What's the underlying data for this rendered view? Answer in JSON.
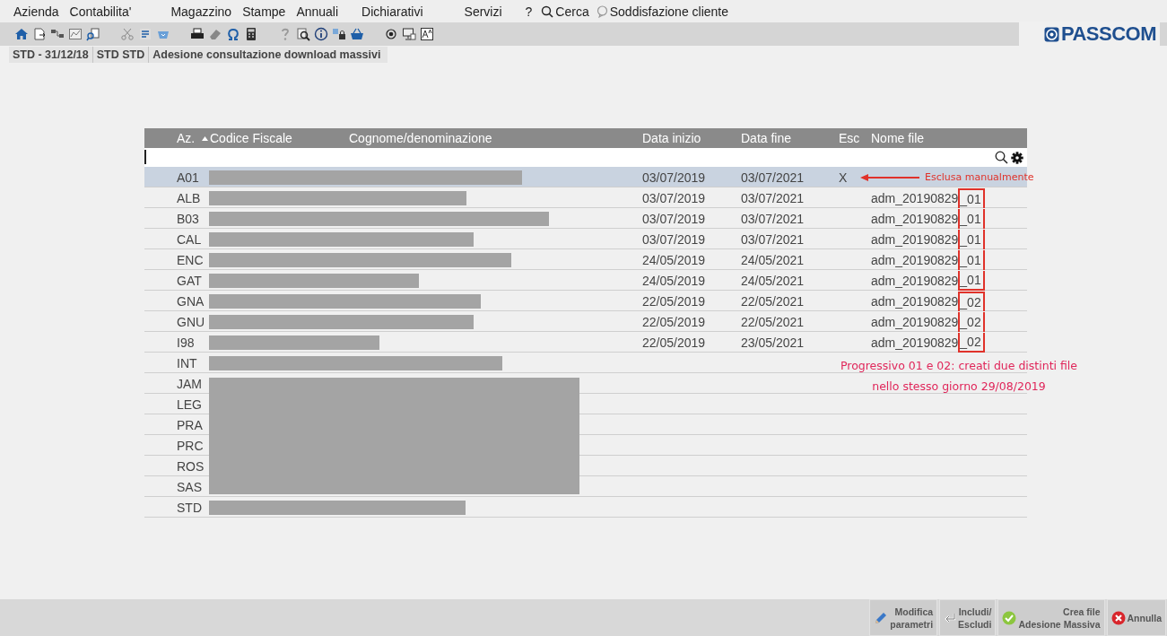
{
  "menu": [
    {
      "label": "Azienda"
    },
    {
      "label": "Contabilita'"
    },
    {
      "label": "Magazzino"
    },
    {
      "label": "Stampe"
    },
    {
      "label": "Annuali"
    },
    {
      "label": "Dichiarativi"
    },
    {
      "label": "Servizi"
    }
  ],
  "help": "?",
  "search_label": "Cerca",
  "satisfaction_label": "Soddisfazione cliente",
  "logo": "PASSCOM",
  "breadcrumbs": [
    "STD - 31/12/18",
    "STD STD",
    "Adesione consultazione download massivi"
  ],
  "table": {
    "columns": [
      "Az.",
      "Codice Fiscale",
      "Cognome/denominazione",
      "Data inizio",
      "Data fine",
      "Esc",
      "Nome file"
    ],
    "rows": [
      {
        "az": "A01",
        "data_inizio": "03/07/2019",
        "data_fine": "03/07/2021",
        "esc": "X",
        "note": "Esclusa manualmente",
        "selected": true
      },
      {
        "az": "ALB",
        "data_inizio": "03/07/2019",
        "data_fine": "03/07/2021",
        "file": "adm_20190829",
        "progressivo": "_01",
        "highlighted": true,
        "selected": false
      },
      {
        "az": "B03",
        "data_inizio": "03/07/2019",
        "data_fine": "03/07/2021",
        "file": "adm_20190829",
        "progressivo": "_01",
        "highlighted": true,
        "selected": false
      },
      {
        "az": "CAL",
        "data_inizio": "03/07/2019",
        "data_fine": "03/07/2021",
        "file": "adm_20190829",
        "progressivo": "_01",
        "highlighted": true,
        "selected": false
      },
      {
        "az": "ENC",
        "data_inizio": "24/05/2019",
        "data_fine": "24/05/2021",
        "file": "adm_20190829",
        "progressivo": "_01",
        "highlighted": true,
        "selected": false
      },
      {
        "az": "GAT",
        "data_inizio": "24/05/2019",
        "data_fine": "24/05/2021",
        "file": "adm_20190829",
        "progressivo": "_01",
        "highlighted": true,
        "selected": false
      },
      {
        "az": "GNA",
        "data_inizio": "22/05/2019",
        "data_fine": "22/05/2021",
        "file": "adm_20190829",
        "progressivo": "_02",
        "highlighted": true,
        "selected": false
      },
      {
        "az": "GNU",
        "data_inizio": "22/05/2019",
        "data_fine": "22/05/2021",
        "file": "adm_20190829",
        "progressivo": "_02",
        "highlighted": true,
        "selected": false
      },
      {
        "az": "I98",
        "data_inizio": "22/05/2019",
        "data_fine": "23/05/2021",
        "file": "adm_20190829",
        "progressivo": "_02",
        "highlighted": true,
        "selected": false
      },
      {
        "az": "INT",
        "annotation": "Progressivo 01 e 02: creati due distinti file",
        "selected": false
      },
      {
        "az": "JAM",
        "annotation": "nello stesso giorno 29/08/2019",
        "selected": false
      },
      {
        "az": "LEG",
        "selected": false
      },
      {
        "az": "PRA",
        "selected": false
      },
      {
        "az": "PRC",
        "selected": false
      },
      {
        "az": "ROS",
        "selected": false
      },
      {
        "az": "SAS",
        "selected": false
      },
      {
        "az": "STD",
        "selected": false
      }
    ]
  },
  "buttons": [
    {
      "kind": "edit",
      "lines": [
        "Modifica",
        "parametri"
      ]
    },
    {
      "kind": "toggle",
      "lines": [
        "Includi/",
        "Escludi"
      ]
    },
    {
      "kind": "confirm",
      "lines": [
        "Crea file",
        "Adesione Massiva"
      ]
    },
    {
      "kind": "cancel",
      "lines": [
        "Annulla"
      ]
    }
  ]
}
